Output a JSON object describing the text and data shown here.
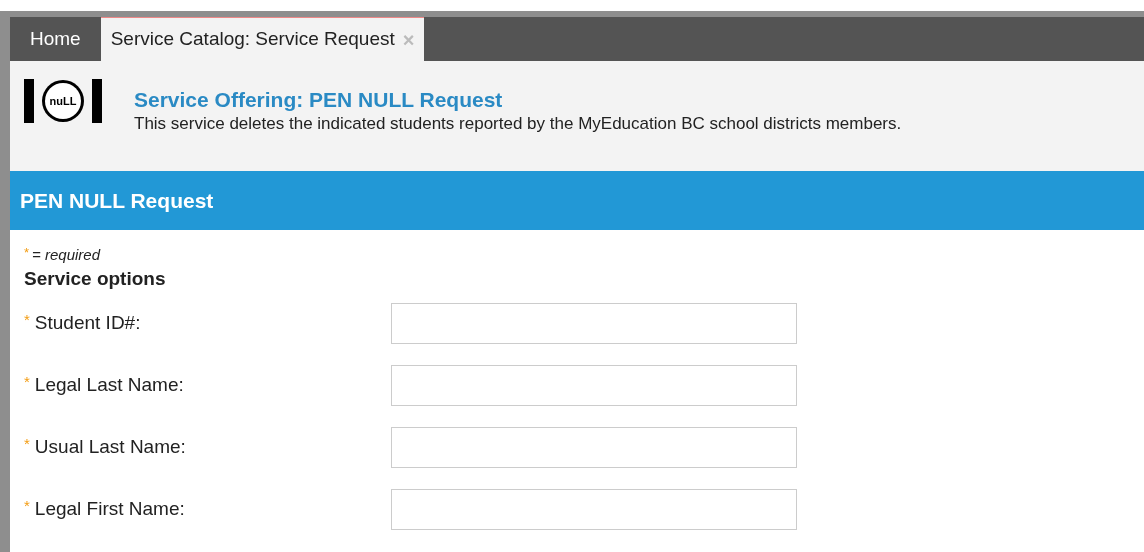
{
  "tabs": [
    {
      "label": "Home",
      "selected": false,
      "closable": false
    },
    {
      "label": "Service Catalog: Service Request",
      "selected": true,
      "closable": true,
      "close_glyph": "×"
    }
  ],
  "header": {
    "logo_text": "nuLL",
    "title": "Service Offering: PEN NULL Request",
    "description": "This service deletes the indicated students reported by the MyEducation BC school districts members."
  },
  "section_bar": {
    "title": "PEN NULL Request"
  },
  "form": {
    "required_legend": {
      "mark": "*",
      "text": "= required"
    },
    "group_title": "Service options",
    "fields": [
      {
        "label": "Student ID#:",
        "required": true,
        "mark": "*"
      },
      {
        "label": "Legal Last Name:",
        "required": true,
        "mark": "*"
      },
      {
        "label": "Usual Last Name:",
        "required": true,
        "mark": "*"
      },
      {
        "label": "Legal First Name:",
        "required": true,
        "mark": "*"
      }
    ]
  }
}
